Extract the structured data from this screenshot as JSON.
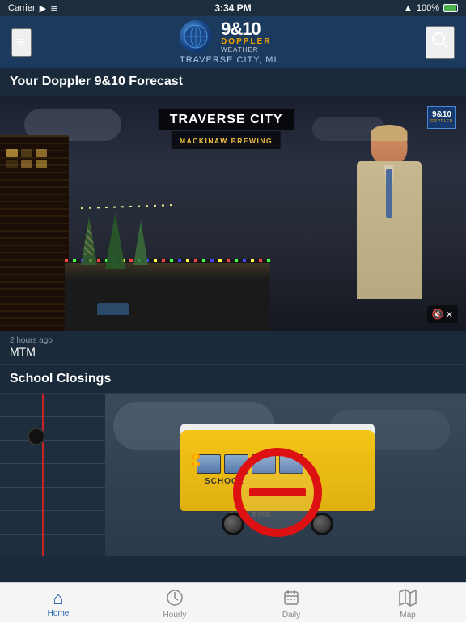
{
  "statusBar": {
    "carrier": "Carrier",
    "time": "3:34 PM",
    "signal": "▲",
    "battery": "100%"
  },
  "navBar": {
    "logo910": "9&10",
    "logoDoppler": "DOPPLER",
    "logoWeather": "WEATHER",
    "location": "TRAVERSE CITY, MI",
    "menuIcon": "≡",
    "searchIcon": "🔍"
  },
  "forecastSection": {
    "title": "Your Doppler 9&10 Forecast"
  },
  "video": {
    "overlayCity": "TRAVERSE CITY",
    "overlaySubtitle": "MACKINAW BREWING",
    "channelNum": "9&10",
    "channelDoppler": "DOPPLER",
    "muteIcon": "🔇",
    "timeAgo": "2 hours ago",
    "label": "MTM"
  },
  "schoolClosings": {
    "sectionTitle": "School Closings",
    "busText": "SCHOOL",
    "busBrand": "BLUE BIRD"
  },
  "tabs": [
    {
      "id": "home",
      "label": "Home",
      "icon": "⌂",
      "active": true
    },
    {
      "id": "hourly",
      "label": "Hourly",
      "icon": "🕐",
      "active": false
    },
    {
      "id": "daily",
      "label": "Daily",
      "icon": "📅",
      "active": false
    },
    {
      "id": "map",
      "label": "Map",
      "icon": "🗺",
      "active": false
    }
  ]
}
